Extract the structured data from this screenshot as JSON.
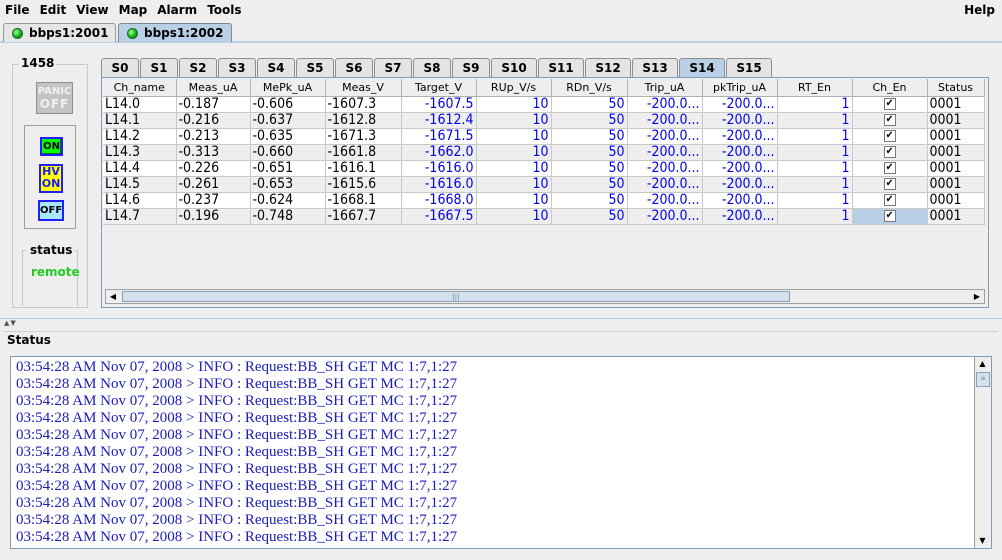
{
  "menu": {
    "file": "File",
    "edit": "Edit",
    "view": "View",
    "map": "Map",
    "alarm": "Alarm",
    "tools": "Tools",
    "help": "Help"
  },
  "connections": [
    {
      "label": "bbps1:2001",
      "selected": false
    },
    {
      "label": "bbps1:2002",
      "selected": true
    }
  ],
  "crate": {
    "id": "1458",
    "panic_top": "PANIC",
    "panic_bottom": "OFF",
    "on_label": "ON",
    "hv_label": "HV",
    "hv_on_label": "ON",
    "off_label": "OFF",
    "status_title": "status",
    "status_value": "remote"
  },
  "slot_tabs": [
    "S0",
    "S1",
    "S2",
    "S3",
    "S4",
    "S5",
    "S6",
    "S7",
    "S8",
    "S9",
    "S10",
    "S11",
    "S12",
    "S13",
    "S14",
    "S15"
  ],
  "selected_slot": "S14",
  "table": {
    "columns": [
      "Ch_name",
      "Meas_uA",
      "MePk_uA",
      "Meas_V",
      "Target_V",
      "RUp_V/s",
      "RDn_V/s",
      "Trip_uA",
      "pkTrip_uA",
      "RT_En",
      "Ch_En",
      "Status"
    ],
    "rows": [
      {
        "name": "L14.0",
        "meas_ua": "-0.187",
        "mepk_ua": "-0.606",
        "meas_v": "-1607.3",
        "target_v": "-1607.5",
        "rup": "10",
        "rdn": "50",
        "trip": "-200.0...",
        "pktrip": "-200.0...",
        "rt_en": "1",
        "ch_en": "✔",
        "status": "0001"
      },
      {
        "name": "L14.1",
        "meas_ua": "-0.216",
        "mepk_ua": "-0.637",
        "meas_v": "-1612.8",
        "target_v": "-1612.4",
        "rup": "10",
        "rdn": "50",
        "trip": "-200.0...",
        "pktrip": "-200.0...",
        "rt_en": "1",
        "ch_en": "✔",
        "status": "0001"
      },
      {
        "name": "L14.2",
        "meas_ua": "-0.213",
        "mepk_ua": "-0.635",
        "meas_v": "-1671.3",
        "target_v": "-1671.5",
        "rup": "10",
        "rdn": "50",
        "trip": "-200.0...",
        "pktrip": "-200.0...",
        "rt_en": "1",
        "ch_en": "✔",
        "status": "0001"
      },
      {
        "name": "L14.3",
        "meas_ua": "-0.313",
        "mepk_ua": "-0.660",
        "meas_v": "-1661.8",
        "target_v": "-1662.0",
        "rup": "10",
        "rdn": "50",
        "trip": "-200.0...",
        "pktrip": "-200.0...",
        "rt_en": "1",
        "ch_en": "✔",
        "status": "0001"
      },
      {
        "name": "L14.4",
        "meas_ua": "-0.226",
        "mepk_ua": "-0.651",
        "meas_v": "-1616.1",
        "target_v": "-1616.0",
        "rup": "10",
        "rdn": "50",
        "trip": "-200.0...",
        "pktrip": "-200.0...",
        "rt_en": "1",
        "ch_en": "✔",
        "status": "0001"
      },
      {
        "name": "L14.5",
        "meas_ua": "-0.261",
        "mepk_ua": "-0.653",
        "meas_v": "-1615.6",
        "target_v": "-1616.0",
        "rup": "10",
        "rdn": "50",
        "trip": "-200.0...",
        "pktrip": "-200.0...",
        "rt_en": "1",
        "ch_en": "✔",
        "status": "0001"
      },
      {
        "name": "L14.6",
        "meas_ua": "-0.237",
        "mepk_ua": "-0.624",
        "meas_v": "-1668.1",
        "target_v": "-1668.0",
        "rup": "10",
        "rdn": "50",
        "trip": "-200.0...",
        "pktrip": "-200.0...",
        "rt_en": "1",
        "ch_en": "✔",
        "status": "0001"
      },
      {
        "name": "L14.7",
        "meas_ua": "-0.196",
        "mepk_ua": "-0.748",
        "meas_v": "-1667.7",
        "target_v": "-1667.5",
        "rup": "10",
        "rdn": "50",
        "trip": "-200.0...",
        "pktrip": "-200.0...",
        "rt_en": "1",
        "ch_en": "✔",
        "status": "0001"
      }
    ]
  },
  "status_panel": {
    "title": "Status",
    "log": [
      "03:54:28 AM Nov 07, 2008 > INFO : Request:BB_SH GET MC 1:7,1:27",
      "03:54:28 AM Nov 07, 2008 > INFO : Request:BB_SH GET MC 1:7,1:27",
      "03:54:28 AM Nov 07, 2008 > INFO : Request:BB_SH GET MC 1:7,1:27",
      "03:54:28 AM Nov 07, 2008 > INFO : Request:BB_SH GET MC 1:7,1:27",
      "03:54:28 AM Nov 07, 2008 > INFO : Request:BB_SH GET MC 1:7,1:27",
      "03:54:28 AM Nov 07, 2008 > INFO : Request:BB_SH GET MC 1:7,1:27",
      "03:54:28 AM Nov 07, 2008 > INFO : Request:BB_SH GET MC 1:7,1:27",
      "03:54:28 AM Nov 07, 2008 > INFO : Request:BB_SH GET MC 1:7,1:27",
      "03:54:28 AM Nov 07, 2008 > INFO : Request:BB_SH GET MC 1:7,1:27",
      "03:54:28 AM Nov 07, 2008 > INFO : Request:BB_SH GET MC 1:7,1:27",
      "03:54:28 AM Nov 07, 2008 > INFO : Request:BB_SH GET MC 1:7,1:27"
    ]
  },
  "colors": {
    "selected_tab": "#b8cfe5",
    "value_blue": "#0000ee",
    "status_green": "#22cc22",
    "log_text": "#1b1bbb"
  }
}
